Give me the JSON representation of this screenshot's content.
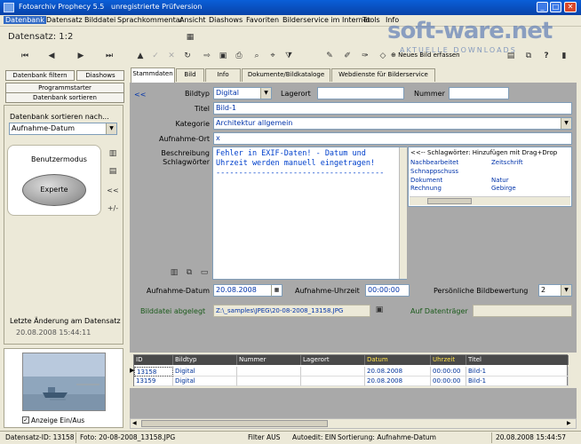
{
  "window": {
    "title": "Fotoarchiv Prophecy 5.5",
    "subtitle": "unregistrierte Prüfversion"
  },
  "menu": [
    "Datenbank",
    "Datensatz",
    "Bilddatei",
    "Sprachkommentar",
    "Ansicht",
    "Diashows",
    "Favoriten",
    "Bilderservice im Internet",
    "Tools",
    "Info"
  ],
  "watermark": {
    "text": "soft-ware.net",
    "sub": "AKTUELLE DOWNLOADS"
  },
  "record": {
    "label": "Datensatz:  1:2"
  },
  "toolbar": {
    "neues_bild": "Neues Bild erfassen"
  },
  "left_buttons": {
    "filter": "Datenbank filtern",
    "diashows": "Diashows",
    "programmstarter": "Programmstarter",
    "sortieren": "Datenbank sortieren"
  },
  "sort": {
    "label": "Datenbank sortieren nach...",
    "value": "Aufnahme-Datum"
  },
  "mode": {
    "label": "Benutzermodus",
    "button": "Experte"
  },
  "side_icons": {
    "back": "<<",
    "plusminus": "+/-"
  },
  "last_change": {
    "label": "Letzte Änderung am Datensatz",
    "value": "20.08.2008 15:44:11"
  },
  "preview": {
    "checkbox": "Anzeige Ein/Aus"
  },
  "tabs": [
    "Stammdaten",
    "Bild",
    "Info",
    "Dokumente/Bildkataloge",
    "Webdienste für Bilderservice"
  ],
  "form": {
    "back": "<<",
    "bildtyp_label": "Bildtyp",
    "bildtyp_value": "Digital",
    "lagerort_label": "Lagerort",
    "lagerort_value": "",
    "nummer_label": "Nummer",
    "nummer_value": "",
    "titel_label": "Titel",
    "titel_value": "Bild-1",
    "kategorie_label": "Kategorie",
    "kategorie_value": "Architektur allgemein",
    "aufnahmeort_label": "Aufnahme-Ort",
    "aufnahmeort_value": "x",
    "beschreibung_label1": "Beschreibung",
    "beschreibung_label2": "Schlagwörter",
    "beschreibung_value": "Fehler in EXIF-Daten! - Datum und\nUhrzeit werden manuell eingetragen!\n-------------------------------------",
    "kw_header": "<<-- Schlagwörter: Hinzufügen mit Drag+Drop",
    "keywords": [
      "Nachbearbeitet",
      "Zeitschrift",
      "Schnappschuss",
      "",
      "Dokument",
      "Natur",
      "Rechnung",
      "Gebirge"
    ],
    "datum_label": "Aufnahme-Datum",
    "datum_value": "20.08.2008",
    "uhrzeit_label": "Aufnahme-Uhrzeit",
    "uhrzeit_value": "00:00:00",
    "bewertung_label": "Persönliche Bildbewertung",
    "bewertung_value": "2",
    "bilddatei_label": "Bilddatei abgelegt",
    "bilddatei_value": "Z:\\_samples\\JPEG\\20-08-2008_13158.JPG",
    "datentraeger_label": "Auf Datenträger",
    "datentraeger_value": ""
  },
  "grid": {
    "headers": [
      "ID",
      "Bildtyp",
      "Nummer",
      "Lagerort",
      "Datum",
      "Uhrzeit",
      "Titel"
    ],
    "rows": [
      [
        "13158",
        "Digital",
        "",
        "",
        "20.08.2008",
        "00:00:00",
        "Bild-1"
      ],
      [
        "13159",
        "Digital",
        "",
        "",
        "20.08.2008",
        "00:00:00",
        "Bild-1"
      ]
    ]
  },
  "status": {
    "id": "Datensatz-ID: 13158",
    "foto": "Foto: 20-08-2008_13158.JPG",
    "filter": "Filter AUS",
    "autoedit": "Autoedit: EIN",
    "sortierung": "Sortierung: Aufnahme-Datum",
    "timestamp": "20.08.2008 15:44:57"
  },
  "colors": {
    "titlebar": "#0842a8",
    "accent_text": "#0033aa",
    "grid_header": "#4a4a4a",
    "highlight_header": "#ffe24a"
  }
}
